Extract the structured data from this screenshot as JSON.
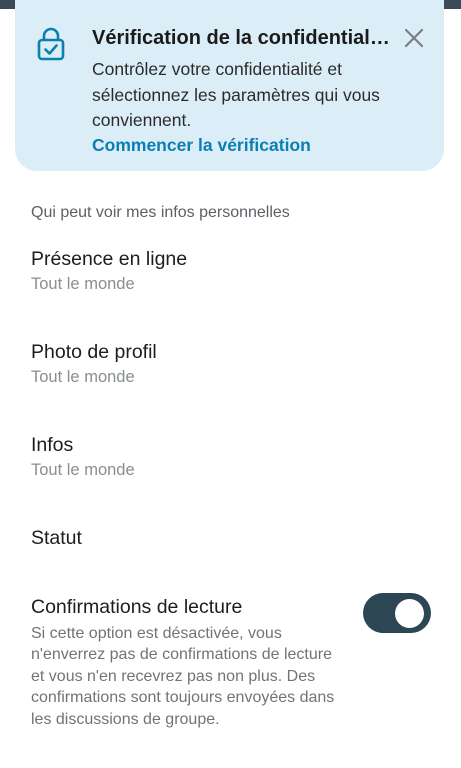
{
  "banner": {
    "title": "Vérification de la confidentialité",
    "body": "Contrôlez votre confidentialité et sélectionnez les paramètres qui vous conviennent.",
    "link": "Commencer la vérification",
    "icon": "lock-check-icon",
    "close_icon": "close-icon"
  },
  "section_header": "Qui peut voir mes infos personnelles",
  "settings": [
    {
      "title": "Présence en ligne",
      "value": "Tout le monde"
    },
    {
      "title": "Photo de profil",
      "value": "Tout le monde"
    },
    {
      "title": "Infos",
      "value": "Tout le monde"
    },
    {
      "title": "Statut",
      "value": ""
    }
  ],
  "read_receipts": {
    "title": "Confirmations de lecture",
    "description": "Si cette option est désactivée, vous n'enverrez pas de confirmations de lecture et vous n'en recevrez pas non plus. Des confirmations sont toujours envoyées dans les discussions de groupe.",
    "enabled": true
  },
  "colors": {
    "accent": "#0b7fb1",
    "banner_bg": "#dbeef8",
    "toggle_on": "#2d4654"
  }
}
